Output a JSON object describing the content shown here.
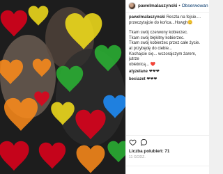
{
  "header": {
    "username": "pawelmalaszynski",
    "separator": "•",
    "follow_label": "Obserwowan"
  },
  "caption": {
    "author": "pawelmalaszynski",
    "lines": [
      "Reszta na fejsie....",
      "przeczytajcie do końca...Howgh😊",
      "Tkam swój czerwony kobierzec.",
      "Tkam swój błękitny kobierzec.",
      "Tkam swój kobierzec przez całe życie.",
      "at przybędę do ciebie...",
      "Kochajcie się... wczorajszym żarem, jutrze",
      "obietnicą... ❤️"
    ]
  },
  "comments": [
    {
      "author": "atyzelane",
      "text": "❤❤❤"
    },
    {
      "author": "beciazet",
      "text": "❤❤❤"
    }
  ],
  "actions": {
    "like_icon": "heart-outline-icon",
    "comment_icon": "speech-bubble-icon",
    "likes_text": "Liczba polubień: 71",
    "date_text": "11 GODZ."
  },
  "comment_box": {
    "placeholder": "Dodaj komentarz..."
  },
  "colors": {
    "accent": "#003569",
    "heart_red": "#e3001b",
    "heart_orange": "#ff8c1a",
    "heart_yellow": "#f7e21b",
    "heart_green": "#2bb534",
    "heart_blue": "#1e90ff"
  }
}
